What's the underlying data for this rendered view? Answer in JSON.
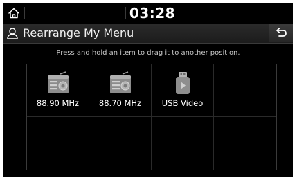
{
  "status_bar": {
    "time": "03:28"
  },
  "header": {
    "title": "Rearrange My Menu"
  },
  "hint": "Press and hold an item to drag it to another position.",
  "menu_items": [
    {
      "label": "88.90 MHz",
      "icon": "radio-icon"
    },
    {
      "label": "88.70 MHz",
      "icon": "radio-icon"
    },
    {
      "label": "USB Video",
      "icon": "usb-video-icon"
    }
  ]
}
